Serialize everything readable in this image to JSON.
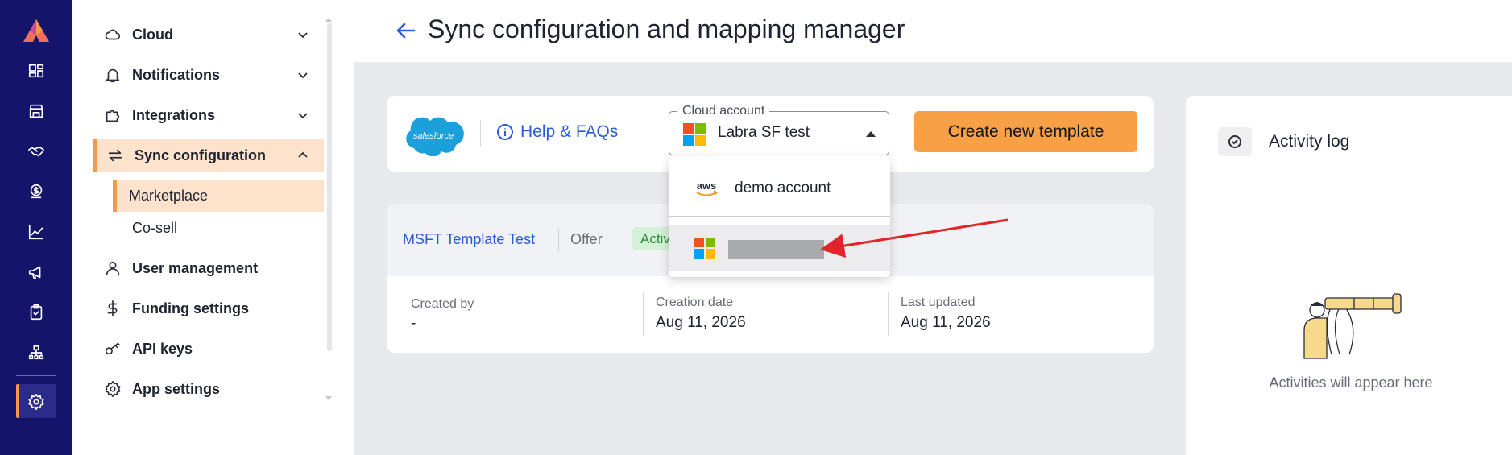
{
  "rail": {
    "icons": [
      "labra-logo",
      "dashboard-icon",
      "storefront-icon",
      "handshake-icon",
      "dollar-shield-icon",
      "chart-line-icon",
      "megaphone-icon",
      "clipboard-check-icon",
      "hierarchy-icon",
      "gear-icon"
    ],
    "active": "gear-icon",
    "accent": "#f59a44",
    "background": "#14146b"
  },
  "sidebar": {
    "items": [
      {
        "label": "Cloud",
        "icon": "cloud-icon",
        "expandable": true
      },
      {
        "label": "Notifications",
        "icon": "bell-icon",
        "expandable": true
      },
      {
        "label": "Integrations",
        "icon": "puzzle-icon",
        "expandable": true
      },
      {
        "label": "Sync configuration",
        "icon": "sync-icon",
        "expandable": true,
        "expanded": true
      },
      {
        "label": "User management",
        "icon": "user-icon"
      },
      {
        "label": "Funding settings",
        "icon": "dollar-icon"
      },
      {
        "label": "API keys",
        "icon": "key-icon"
      },
      {
        "label": "App settings",
        "icon": "gear-icon"
      }
    ],
    "sub_items": [
      {
        "label": "Marketplace",
        "active": true
      },
      {
        "label": "Co-sell",
        "active": false
      }
    ]
  },
  "header": {
    "title": "Sync configuration and mapping manager"
  },
  "toolbar": {
    "help_label": "Help & FAQs",
    "cloud_account_label": "Cloud account",
    "cloud_account_value": "Labra SF test",
    "create_label": "Create new template"
  },
  "dropdown": {
    "options": [
      {
        "label": "demo account",
        "icon": "aws-icon"
      },
      {
        "label": "",
        "icon": "microsoft-icon",
        "redacted": true,
        "highlighted": true
      }
    ]
  },
  "template": {
    "name": "MSFT Template Test",
    "type": "Offer",
    "status": "Active",
    "created_by_label": "Created by",
    "created_by_value": "-",
    "creation_date_label": "Creation date",
    "creation_date_value": "Aug 11, 2026",
    "last_updated_label": "Last updated",
    "last_updated_value": "Aug 11, 2026"
  },
  "activity": {
    "title": "Activity log",
    "empty_text": "Activities will appear here"
  },
  "colors": {
    "primary_blue": "#2a5bd7",
    "accent_orange": "#f7a045",
    "active_bg": "#fde2cc",
    "arrow_red": "#e0242a"
  }
}
